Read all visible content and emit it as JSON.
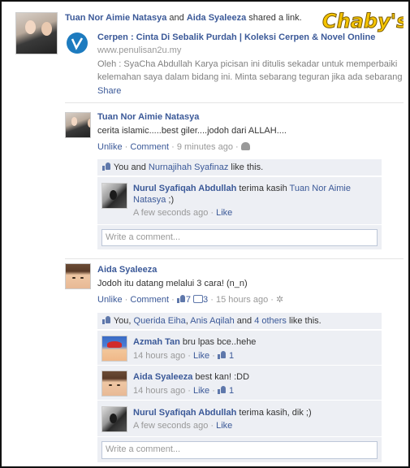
{
  "story": {
    "actor1": "Tuan Nor Aimie Natasya",
    "and_text": "and",
    "actor2": "Aida Syaleeza",
    "action": "shared a link.",
    "logo_text": "Chaby's"
  },
  "link_preview": {
    "title": "Cerpen : Cinta Di Sebalik Purdah | Koleksi Cerpen & Novel Online",
    "domain": "www.penulisan2u.my",
    "description_line1": "Oleh : SyaCha Abdullah Karya picisan ini ditulis sekadar untuk memperbaiki",
    "description_line2": "kelemahan saya dalam bidang ini. Minta sebarang teguran jika ada sebarang",
    "share_label": "Share"
  },
  "post1": {
    "author": "Tuan Nor Aimie Natasya",
    "text": "cerita islamic.....best giler....jodoh dari ALLAH....",
    "unlike": "Unlike",
    "comment": "Comment",
    "time": "9 minutes ago",
    "likes_text": "You and ",
    "likes_name": "Nurnajihah Syafinaz",
    "likes_suffix": " like this.",
    "reply": {
      "author": "Nurul Syafiqah Abdullah",
      "text_prefix": " terima kasih ",
      "mention_line1": "Tuan Nor Aimie",
      "mention_line2": "Natasya",
      "text_suffix": " ;)",
      "time": "A few seconds ago",
      "like": "Like"
    },
    "comment_placeholder": "Write a comment..."
  },
  "post2": {
    "author": "Aida Syaleeza",
    "text": "Jodoh itu datang melalui 3 cara! (n_n)",
    "unlike": "Unlike",
    "comment": "Comment",
    "likes_count": "7",
    "comments_count": "3",
    "time": "15 hours ago",
    "likes_you": "You, ",
    "likes_name1": "Querida Eiha",
    "likes_comma": ", ",
    "likes_name2": "Anis Aqilah",
    "likes_and": " and ",
    "likes_others": "4 others",
    "likes_suffix": " like this.",
    "replies": [
      {
        "author": "Azmah Tan",
        "text": " bru lpas bce..hehe",
        "time": "14 hours ago",
        "like": "Like",
        "count": "1"
      },
      {
        "author": "Aida Syaleeza",
        "text": " best kan! :DD",
        "time": "14 hours ago",
        "like": "Like",
        "count": "1"
      },
      {
        "author": "Nurul Syafiqah Abdullah",
        "text": " terima kasih, dik ;)",
        "time": "A few seconds ago",
        "like": "Like"
      }
    ],
    "comment_placeholder": "Write a comment..."
  },
  "colors": {
    "link": "#3b5998",
    "comment_bg": "#edeff4",
    "logo_fill": "#f5c400"
  }
}
